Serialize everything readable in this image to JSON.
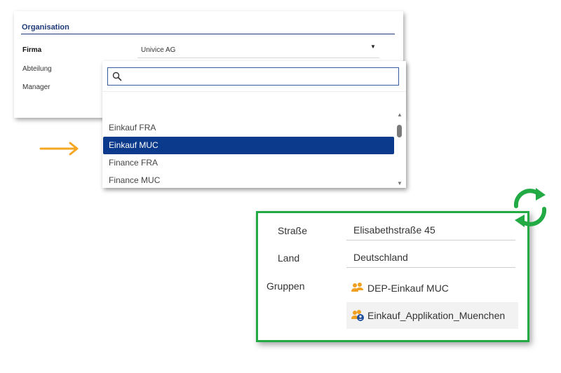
{
  "organisation": {
    "title": "Organisation",
    "fields": {
      "firma_label": "Firma",
      "firma_value": "Univice AG",
      "abteilung_label": "Abteilung",
      "manager_label": "Manager"
    },
    "caret": "▼"
  },
  "dropdown": {
    "search_value": "",
    "items": [
      {
        "label": "Einkauf FRA",
        "selected": false
      },
      {
        "label": "Einkauf MUC",
        "selected": true
      },
      {
        "label": "Finance FRA",
        "selected": false
      },
      {
        "label": "Finance MUC",
        "selected": false
      }
    ],
    "scroll_up": "▲",
    "scroll_down": "▼"
  },
  "result": {
    "strasse_label": "Straße",
    "strasse_value": "Elisabethstraße 45",
    "land_label": "Land",
    "land_value": "Deutschland",
    "gruppen_label": "Gruppen",
    "groups": [
      {
        "label": "DEP-Einkauf MUC",
        "icon": "group-icon"
      },
      {
        "label": "Einkauf_Applikation_Muenchen",
        "icon": "group-user-icon"
      }
    ]
  },
  "colors": {
    "navy": "#1f3a7a",
    "selected_bg": "#0b3a8c",
    "accent_orange": "#f5a623",
    "accent_green": "#22aa44",
    "group_icon": "#f0a020"
  }
}
